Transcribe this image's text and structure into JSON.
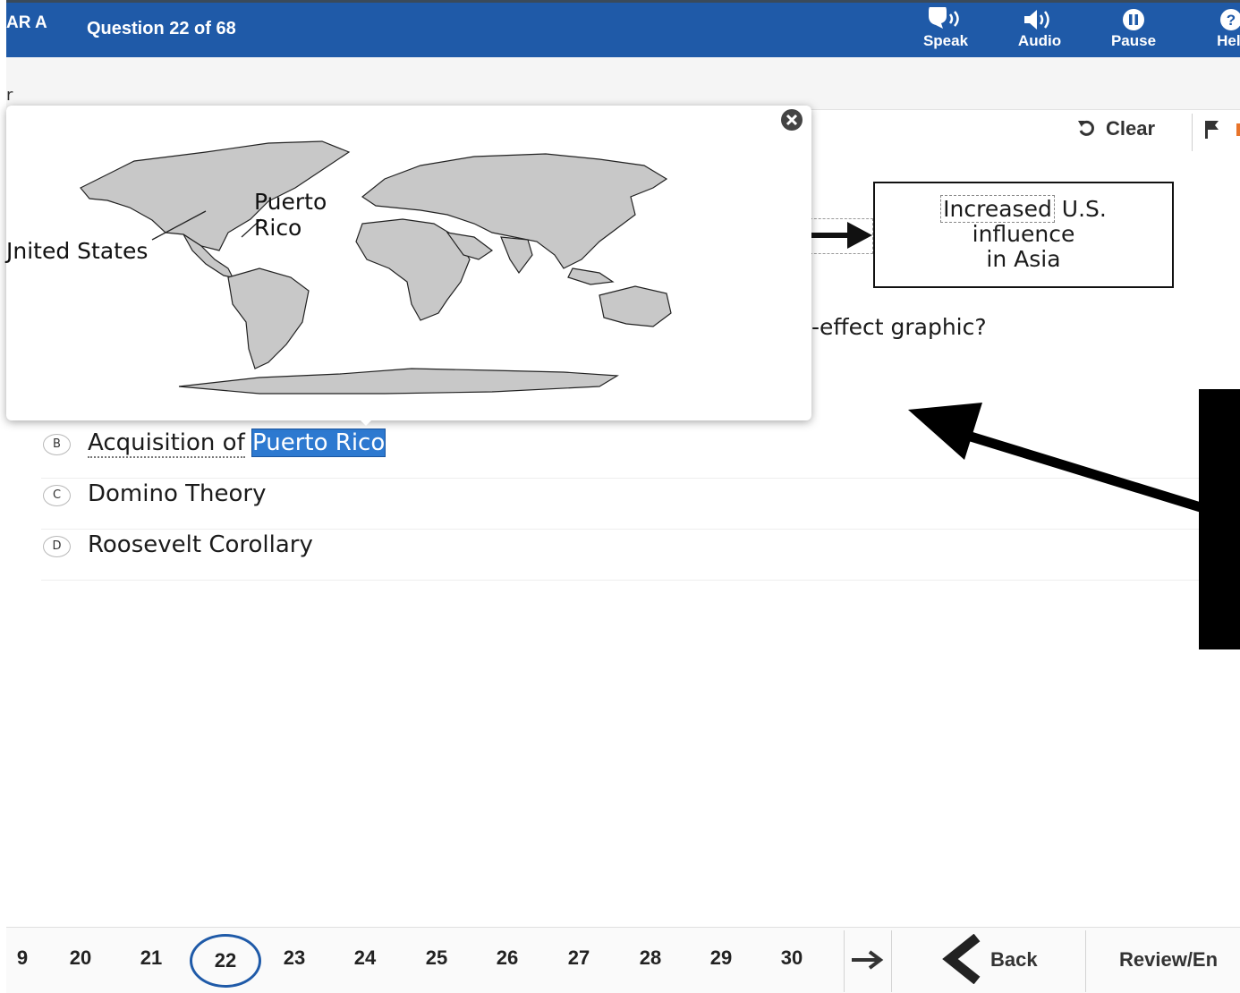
{
  "header": {
    "test_name": "AR A",
    "question_label": "Question 22 of 68",
    "tools": [
      {
        "label": "Speak",
        "icon": "speak-icon"
      },
      {
        "label": "Audio",
        "icon": "audio-icon"
      },
      {
        "label": "Pause",
        "icon": "pause-icon"
      },
      {
        "label": "Help",
        "icon": "help-icon"
      }
    ]
  },
  "subbar": {
    "text": "r"
  },
  "toolbar": {
    "clear_label": "Clear"
  },
  "graphic": {
    "effect_line1": "Increased",
    "effect_line1b": "U.S.",
    "effect_line2": "influence",
    "effect_line3": "in Asia"
  },
  "question": {
    "text_visible": "-effect graphic?"
  },
  "popup": {
    "label_puerto": "Puerto",
    "label_rico": "Rico",
    "label_us": "Jnited States"
  },
  "options": [
    {
      "letter": "B",
      "text_prefix": "Acquisition of",
      "text_highlight": "Puerto Rico"
    },
    {
      "letter": "C",
      "text": "Domino Theory"
    },
    {
      "letter": "D",
      "text": "Roosevelt Corollary"
    }
  ],
  "navigation": {
    "question_numbers": [
      "9",
      "20",
      "21",
      "22",
      "23",
      "24",
      "25",
      "26",
      "27",
      "28",
      "29",
      "30"
    ],
    "current": "22",
    "back_label": "Back",
    "review_label": "Review/En"
  },
  "colors": {
    "header_bg": "#1f5aa8",
    "highlight": "#2d79d0",
    "flag_accent": "#e8742a"
  }
}
